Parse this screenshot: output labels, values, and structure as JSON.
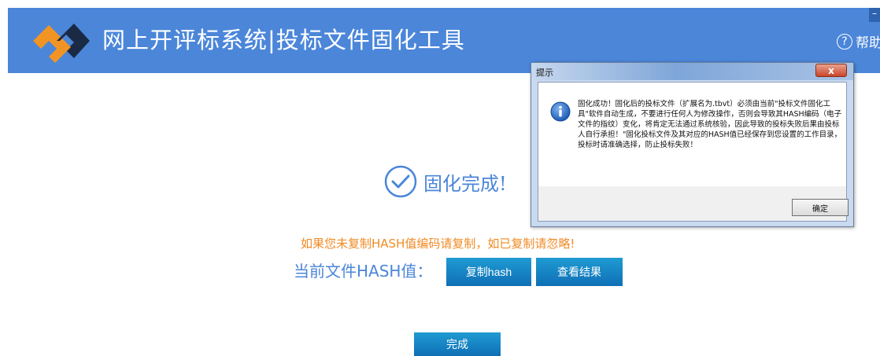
{
  "header": {
    "title": "网上开评标系统|投标文件固化工具",
    "help_label": "帮助",
    "minimize_glyph": "–"
  },
  "status": {
    "done_text": "固化完成!"
  },
  "notice": "如果您未复制HASH值编码请复制，如已复制请忽略!",
  "hash_label": "当前文件HASH值：",
  "buttons": {
    "copy_hash": "复制hash",
    "view_result": "查看结果",
    "finish": "完成"
  },
  "dialog": {
    "title": "提示",
    "close_glyph": "x",
    "message": "固化成功！固化后的投标文件（扩展名为.tbvt）必须由当前\"投标文件固化工具\"软件自动生成，不要进行任何人为修改操作，否则会导致其HASH编码（电子文件的指纹）变化，将肯定无法通过系统核验，因此导致的投标失败后果由投标人自行承担！\"固化投标文件及其对应的HASH值已经保存到您设置的工作目录，投标时请准确选择，防止投标失败！",
    "ok_label": "确定"
  },
  "colors": {
    "header_bg": "#4b86d9",
    "accent_blue": "#4b86d9",
    "notice_orange": "#f08a24",
    "button_blue": "#1a8ac8"
  }
}
